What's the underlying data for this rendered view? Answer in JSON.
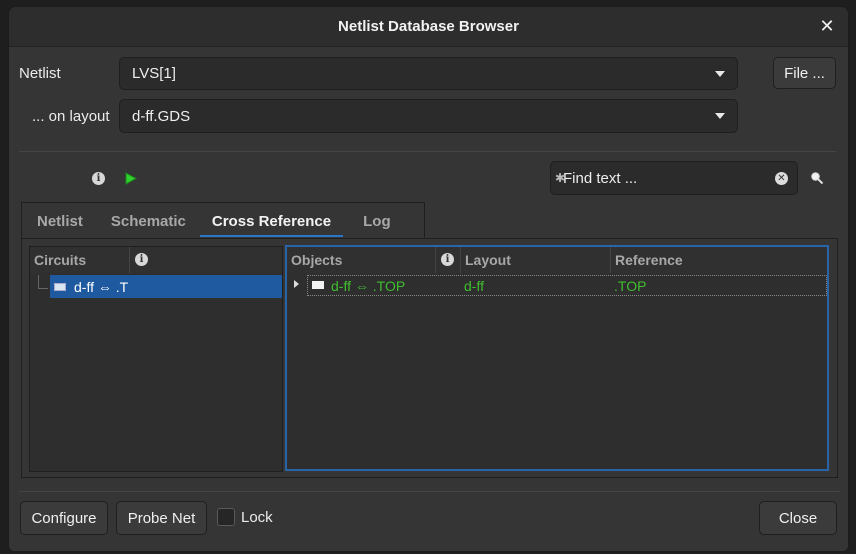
{
  "window": {
    "title": "Netlist Database Browser"
  },
  "form": {
    "netlist_label": "Netlist",
    "netlist_value": "LVS[1]",
    "layout_label": "... on layout",
    "layout_value": "d-ff.GDS",
    "file_button": "File ..."
  },
  "search": {
    "placeholder": "Find text ..."
  },
  "tabs": [
    {
      "label": "Netlist"
    },
    {
      "label": "Schematic"
    },
    {
      "label": "Cross Reference"
    },
    {
      "label": "Log"
    }
  ],
  "circuits": {
    "header": "Circuits",
    "items": [
      {
        "label": "d-ff ⇔ .T"
      }
    ]
  },
  "objects": {
    "headers": {
      "objects": "Objects",
      "layout": "Layout",
      "reference": "Reference"
    },
    "rows": [
      {
        "object": "d-ff ⇔ .TOP",
        "layout": "d-ff",
        "reference": ".TOP",
        "color": "#3fbf2f"
      }
    ]
  },
  "footer": {
    "configure": "Configure",
    "probe_net": "Probe Net",
    "lock": "Lock",
    "close": "Close"
  },
  "colors": {
    "accent": "#2a76c6",
    "selection": "#1f5aa0",
    "match": "#3fbf2f"
  }
}
